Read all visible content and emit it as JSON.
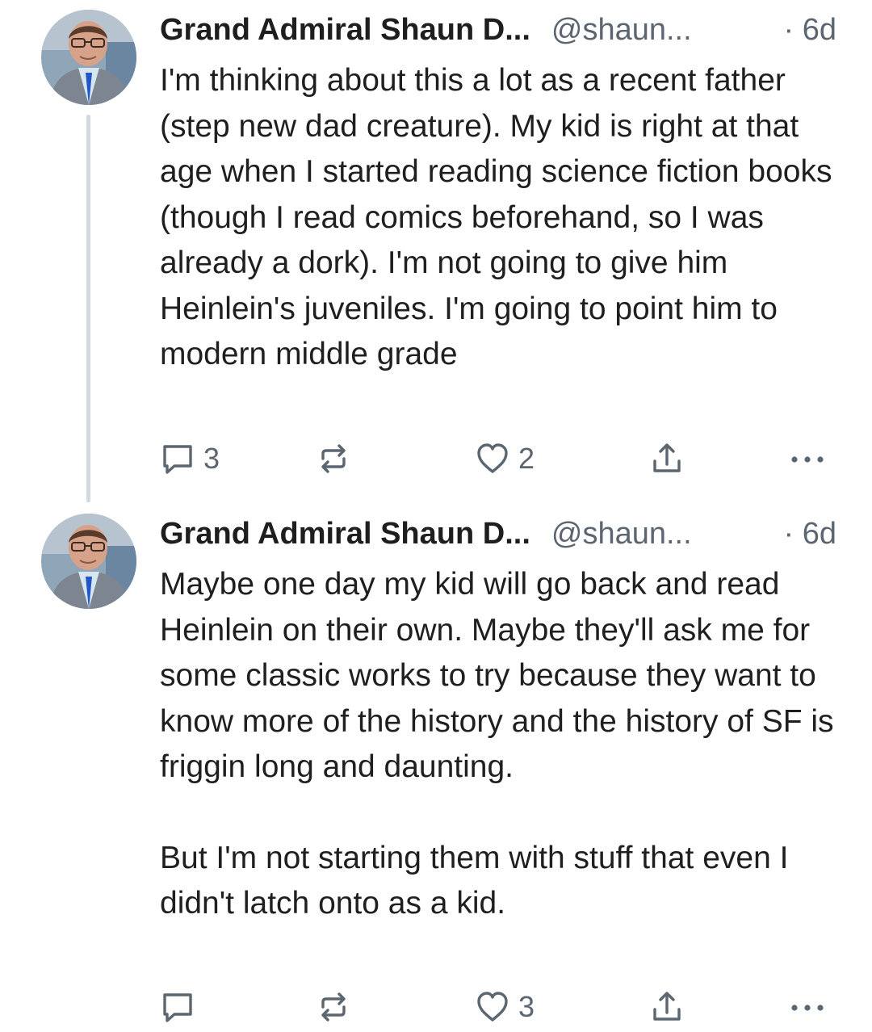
{
  "posts": [
    {
      "author": {
        "display_name": "Grand Admiral Shaun D...",
        "handle": "@shaun..."
      },
      "timestamp": "· 6d",
      "body": [
        "I'm thinking about this a lot as a recent father (step new dad creature). My kid is right at that age when I started reading science fiction books (though I read comics beforehand, so I was already a dork). I'm not going to give him Heinlein's juveniles. I'm going to point him to modern middle grade"
      ],
      "reply_count": "3",
      "like_count": "2"
    },
    {
      "author": {
        "display_name": "Grand Admiral Shaun D...",
        "handle": "@shaun..."
      },
      "timestamp": "· 6d",
      "body": [
        "Maybe one day my kid will go back and read Heinlein on their own. Maybe they'll ask me for some classic works to try because they want to know more of the history and the history of SF is friggin long and daunting.",
        "But I'm not starting them with stuff that even I didn't latch onto as a kid."
      ],
      "reply_count": "",
      "like_count": "3"
    }
  ],
  "icons": {
    "reply": "speech-bubble-icon",
    "repost": "repost-arrows-icon",
    "like": "heart-icon",
    "share": "share-upload-icon",
    "more": "ellipsis-icon"
  },
  "colors": {
    "text": "#1f1f1f",
    "muted": "#5b6670",
    "thread_line": "#d4d9df",
    "background": "#ffffff"
  }
}
